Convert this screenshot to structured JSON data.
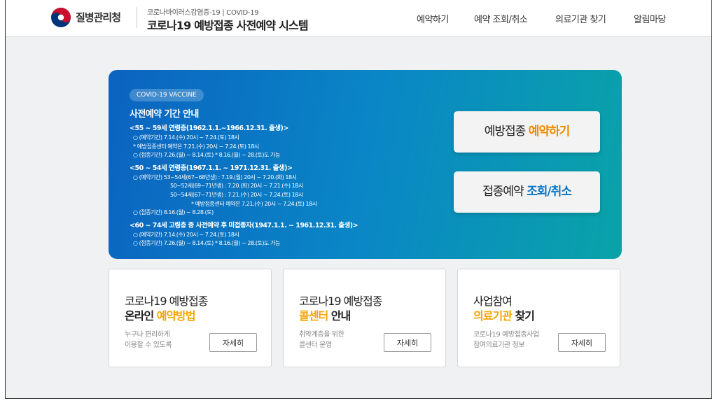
{
  "header": {
    "org_name": "질병관리청",
    "subtitle": "코로나바이러스감염증-19 | COVID-19",
    "title": "코로나19 예방접종 사전예약 시스템",
    "nav": [
      "예약하기",
      "예약 조회/취소",
      "의료기관 찾기",
      "알림마당"
    ]
  },
  "banner": {
    "badge": "COVID-19 VACCINE",
    "heading": "사전예약 기간 안내",
    "groups": [
      {
        "title": "<55 ~ 59세 연령층(1962.1.1.~1966.12.31. 출생)>",
        "lines": [
          "○ (예약기간) 7.14.(수) 20시 ~ 7.24.(토) 18시",
          "* 예방접종센터 예약은 7.21.(수) 20시 ~ 7.24.(토) 18시",
          "○ (접종기간) 7.26.(월) ~ 8.14.(토)      * 8.16.(월) ~ 28.(토)도 가능"
        ]
      },
      {
        "title": "<50 ~ 54세 연령층(1967.1.1. ~ 1971.12.31. 출생)>",
        "lines": [
          "○ (예약기간) 53~54세(67~68년생) : 7.19.(월) 20시 ~ 7.20.(화) 18시",
          "50~52세(69~71년생) : 7.20.(화) 20시 ~ 7.21.(수) 18시",
          "50~54세(67~71년생) : 7.21.(수) 20시 ~ 7.24.(토) 18시",
          "* 예방접종센터 예약은 7.21.(수) 20시 ~ 7.24.(토) 18시",
          "○ (접종기간) 8.16.(월) ~ 8.28.(토)"
        ]
      },
      {
        "title": "<60 ~ 74세 고령층 중 사전예약 후 미접종자(1947.1.1. ~ 1961.12.31. 출생)>",
        "lines": [
          "○ (예약기간) 7.14.(수) 20시 ~ 7.24.(토) 18시",
          "○ (접종기간) 7.26.(월) ~ 8.14.(토)      * 8.16.(월) ~ 28.(토)도 가능"
        ]
      }
    ],
    "cta_book": {
      "prefix": "예방접종 ",
      "accent": "예약하기"
    },
    "cta_check": {
      "prefix": "접종예약 ",
      "accent": "조회/취소"
    }
  },
  "cards": [
    {
      "title_line1": "코로나19 예방접종",
      "title_line2_a": "온라인 ",
      "title_line2_b": "예약방법",
      "title_line2_c": "",
      "desc1": "누구나 편리하게",
      "desc2": "이용할 수 있도록",
      "button": "자세히"
    },
    {
      "title_line1": "코로나19 예방접종",
      "title_line2_a": "",
      "title_line2_b": "콜센터",
      "title_line2_c": " 안내",
      "desc1": "취약계층을 위한",
      "desc2": "콜센터 운영",
      "button": "자세히"
    },
    {
      "title_line1": "사업참여",
      "title_line2_a": "",
      "title_line2_b": "의료기관",
      "title_line2_c": " 찾기",
      "desc1": "코로나19 예방접종사업",
      "desc2": "참여의료기관 정보",
      "button": "자세히"
    }
  ],
  "colors": {
    "orange": "#f18a00",
    "blue": "#0b76c5",
    "yellow": "#f4a400",
    "logo_red": "#c8102e",
    "logo_blue": "#003478"
  }
}
